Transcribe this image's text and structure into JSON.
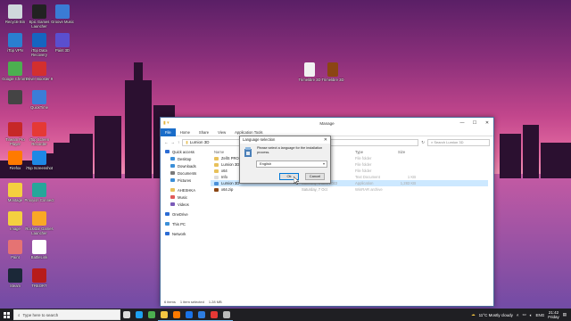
{
  "desktop_icons": [
    {
      "label": "Recycle Bin",
      "color": "#cfd8dc"
    },
    {
      "label": "Epic Games Launcher",
      "color": "#222222"
    },
    {
      "label": "Groove Music",
      "color": "#3a7bd5"
    },
    {
      "label": "iTop VPN",
      "color": "#2a7fd0"
    },
    {
      "label": "iTop Data Recovery",
      "color": "#1565c0"
    },
    {
      "label": "Paint 3D",
      "color": "#5a4fcf"
    },
    {
      "label": "Google Chrome",
      "color": "#4caf50"
    },
    {
      "label": "Driver Booster 9",
      "color": "#d32f2f"
    },
    {
      "label": "",
      "color": "#444444"
    },
    {
      "label": "QuickTime",
      "color": "#3b7dd8"
    },
    {
      "label": "Tineam Pro Player",
      "color": "#c62828"
    },
    {
      "label": "iTop Screen Recorder",
      "color": "#e53935"
    },
    {
      "label": "Firefox",
      "color": "#ff7a00"
    },
    {
      "label": "iTop Screenshot",
      "color": "#1e88e5"
    },
    {
      "label": "Montage",
      "color": "#f4d03f"
    },
    {
      "label": "Proxyion Connect",
      "color": "#26a69a"
    },
    {
      "label": "Image",
      "color": "#f4d03f"
    },
    {
      "label": "Rockstar Games Launcher",
      "color": "#f9a825"
    },
    {
      "label": "Paint",
      "color": "#e57373"
    },
    {
      "label": "BattleLink",
      "color": "#ffffff"
    },
    {
      "label": "Steam",
      "color": "#1b2838"
    },
    {
      "label": "TREORT",
      "color": "#b71c1c"
    }
  ],
  "desktop_files": [
    {
      "label": "Trimelibre 3D",
      "color": "#f1f1f1"
    },
    {
      "label": "Trimelibre 3D",
      "color": "#8b4513"
    }
  ],
  "explorer": {
    "title": "Manage",
    "tabs": [
      "File",
      "Home",
      "Share",
      "View",
      "Application Tools"
    ],
    "address": "Lumion 3D",
    "search_placeholder": "Search Lumion 3D",
    "nav": [
      {
        "label": "Quick access",
        "color": "#2b6cd4"
      },
      {
        "label": "Desktop",
        "color": "#3b8fd8"
      },
      {
        "label": "Downloads",
        "color": "#3b8fd8"
      },
      {
        "label": "Documents",
        "color": "#7a7a7a"
      },
      {
        "label": "Pictures",
        "color": "#3b8fd8"
      },
      {
        "label": "AHESHKA",
        "color": "#e8c15a"
      },
      {
        "label": "Music",
        "color": "#e05a5a"
      },
      {
        "label": "Videos",
        "color": "#7a5ab8"
      },
      {
        "label": "OneDrive",
        "color": "#2b6cd4"
      },
      {
        "label": "This PC",
        "color": "#3b8fd8"
      },
      {
        "label": "Network",
        "color": "#2b6cd4"
      }
    ],
    "columns": [
      "Name",
      "Date modified",
      "Type",
      "Size"
    ],
    "files": [
      {
        "name": "ZellS PROFILS",
        "date": "",
        "type": "File folder",
        "size": "",
        "icon_color": "#e8c15a",
        "selected": false
      },
      {
        "name": "Lumion 3D",
        "date": "",
        "type": "File folder",
        "size": "",
        "icon_color": "#e8c15a",
        "selected": false
      },
      {
        "name": "x64",
        "date": "",
        "type": "File folder",
        "size": "",
        "icon_color": "#e8c15a",
        "selected": false
      },
      {
        "name": "Info",
        "date": "",
        "type": "Text Document",
        "size": "1 KB",
        "icon_color": "#dddddd",
        "selected": false
      },
      {
        "name": "Lumion 3D",
        "date": "Saturday, 3 Dec 2022",
        "type": "Application",
        "size": "1,283 KB",
        "icon_color": "#4a90d9",
        "selected": true
      },
      {
        "name": "x64.zip",
        "date": "Saturday, 7 Oct",
        "type": "WinRAR archive",
        "size": "",
        "icon_color": "#8b4513",
        "selected": false
      }
    ],
    "status": [
      "6 items",
      "1 item selected",
      "1.28 MB"
    ]
  },
  "dialog": {
    "title": "Language selection",
    "message": "Please select a language for the installation process.",
    "language": "English",
    "ok_label": "Ok",
    "cancel_label": "Cancel"
  },
  "taskbar": {
    "search_placeholder": "Type here to search",
    "apps": [
      {
        "name": "task-view",
        "color": "#dddddd"
      },
      {
        "name": "edge",
        "color": "#1ea1f2"
      },
      {
        "name": "chrome",
        "color": "#4caf50"
      },
      {
        "name": "file-explorer",
        "color": "#f4c542"
      },
      {
        "name": "firefox",
        "color": "#ff7a00"
      },
      {
        "name": "store",
        "color": "#1a73e8"
      },
      {
        "name": "mail",
        "color": "#2d7de0"
      },
      {
        "name": "media",
        "color": "#e53935"
      },
      {
        "name": "installer",
        "color": "#bbbbbb"
      }
    ],
    "weather": "11°C  Mostly cloudy",
    "language": "ENG",
    "time": "21:42",
    "day": "Friday"
  }
}
